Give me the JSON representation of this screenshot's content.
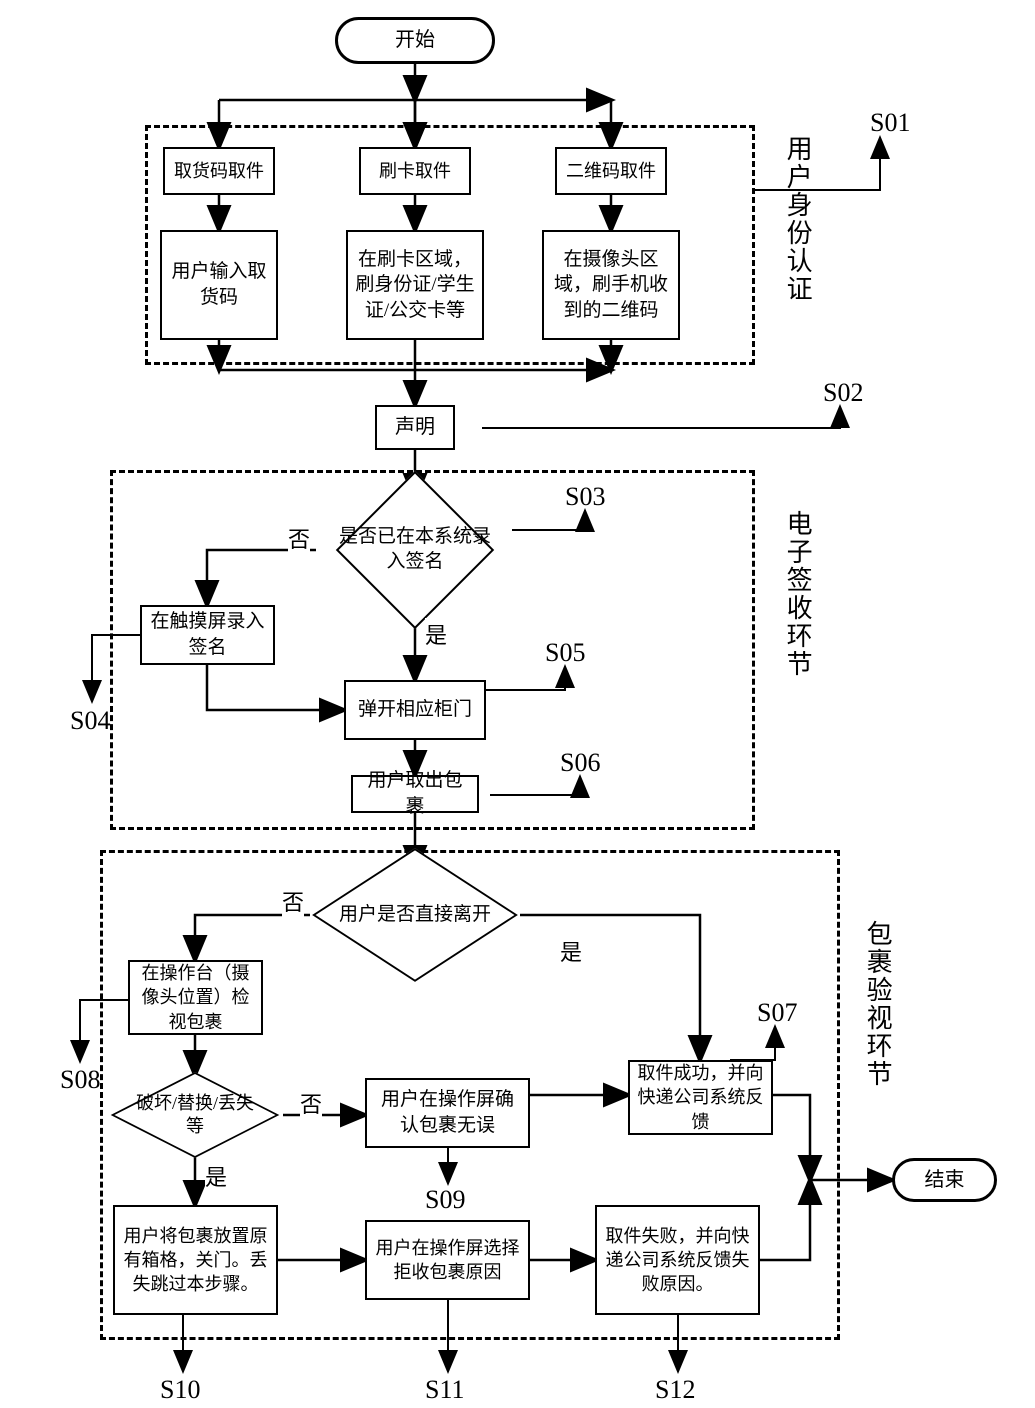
{
  "terminators": {
    "start": "开始",
    "end": "结束"
  },
  "groups": {
    "s01_title": "用户身份认证",
    "s01_seq": "S01",
    "sign_title": "电子签收环节",
    "inspect_title": "包裹验视环节"
  },
  "s01": {
    "opt1_title": "取货码取件",
    "opt1_desc": "用户输入取货码",
    "opt2_title": "刷卡取件",
    "opt2_desc": "在刷卡区域，刷身份证/学生证/公交卡等",
    "opt3_title": "二维码取件",
    "opt3_desc": "在摄像头区域，刷手机收到的二维码"
  },
  "s02": {
    "label": "声明",
    "seq": "S02"
  },
  "s03": {
    "text": "是否已在本系统录入签名",
    "seq": "S03",
    "yes": "是",
    "no": "否"
  },
  "s04": {
    "label": "在触摸屏录入签名",
    "seq": "S04"
  },
  "s05": {
    "label": "弹开相应柜门",
    "seq": "S05"
  },
  "s06": {
    "label": "用户取出包裹",
    "seq": "S06"
  },
  "d2": {
    "text": "用户是否直接离开",
    "yes": "是",
    "no": "否"
  },
  "s07": {
    "label": "取件成功，并向快递公司系统反馈",
    "seq": "S07"
  },
  "s08": {
    "label": "在操作台（摄像头位置）检视包裹",
    "seq": "S08"
  },
  "d3": {
    "text": "破坏/替换/丢失等",
    "yes": "是",
    "no": "否"
  },
  "s09": {
    "label": "用户在操作屏确认包裹无误",
    "seq": "S09"
  },
  "s10": {
    "label": "用户将包裹放置原有箱格，关门。丢失跳过本步骤。",
    "seq": "S10"
  },
  "s11": {
    "label": "用户在操作屏选择拒收包裹原因",
    "seq": "S11"
  },
  "s12": {
    "label": "取件失败，并向快递公司系统反馈失败原因。",
    "seq": "S12"
  }
}
